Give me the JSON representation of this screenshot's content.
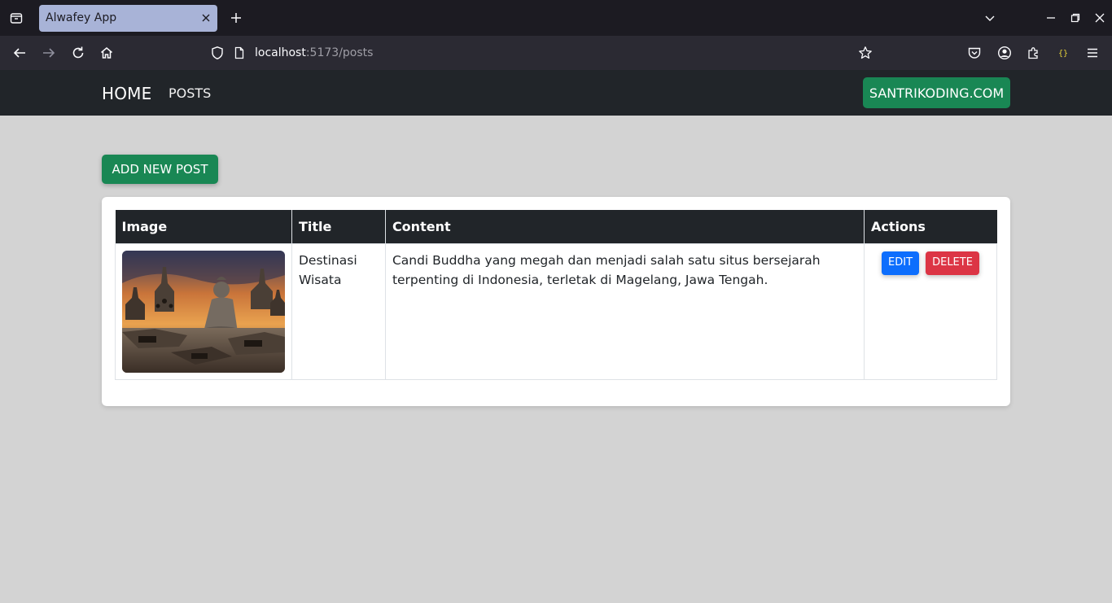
{
  "browser": {
    "tab_title": "Alwafey App",
    "url_host": "localhost",
    "url_path": ":5173/posts"
  },
  "navbar": {
    "brand": "HOME",
    "posts_link": "POSTS",
    "site_button": "SANTRIKODING.COM"
  },
  "main": {
    "add_button": "ADD NEW POST",
    "table": {
      "headers": [
        "Image",
        "Title",
        "Content",
        "Actions"
      ],
      "rows": [
        {
          "title": "Destinasi Wisata",
          "content": "Candi Buddha yang megah dan menjadi salah satu situs bersejarah terpenting di Indonesia, terletak di Magelang, Jawa Tengah.",
          "edit_label": "EDIT",
          "delete_label": "DELETE"
        }
      ]
    }
  },
  "colors": {
    "success": "#198754",
    "primary": "#0d6efd",
    "danger": "#dc3545",
    "dark": "#212529"
  }
}
